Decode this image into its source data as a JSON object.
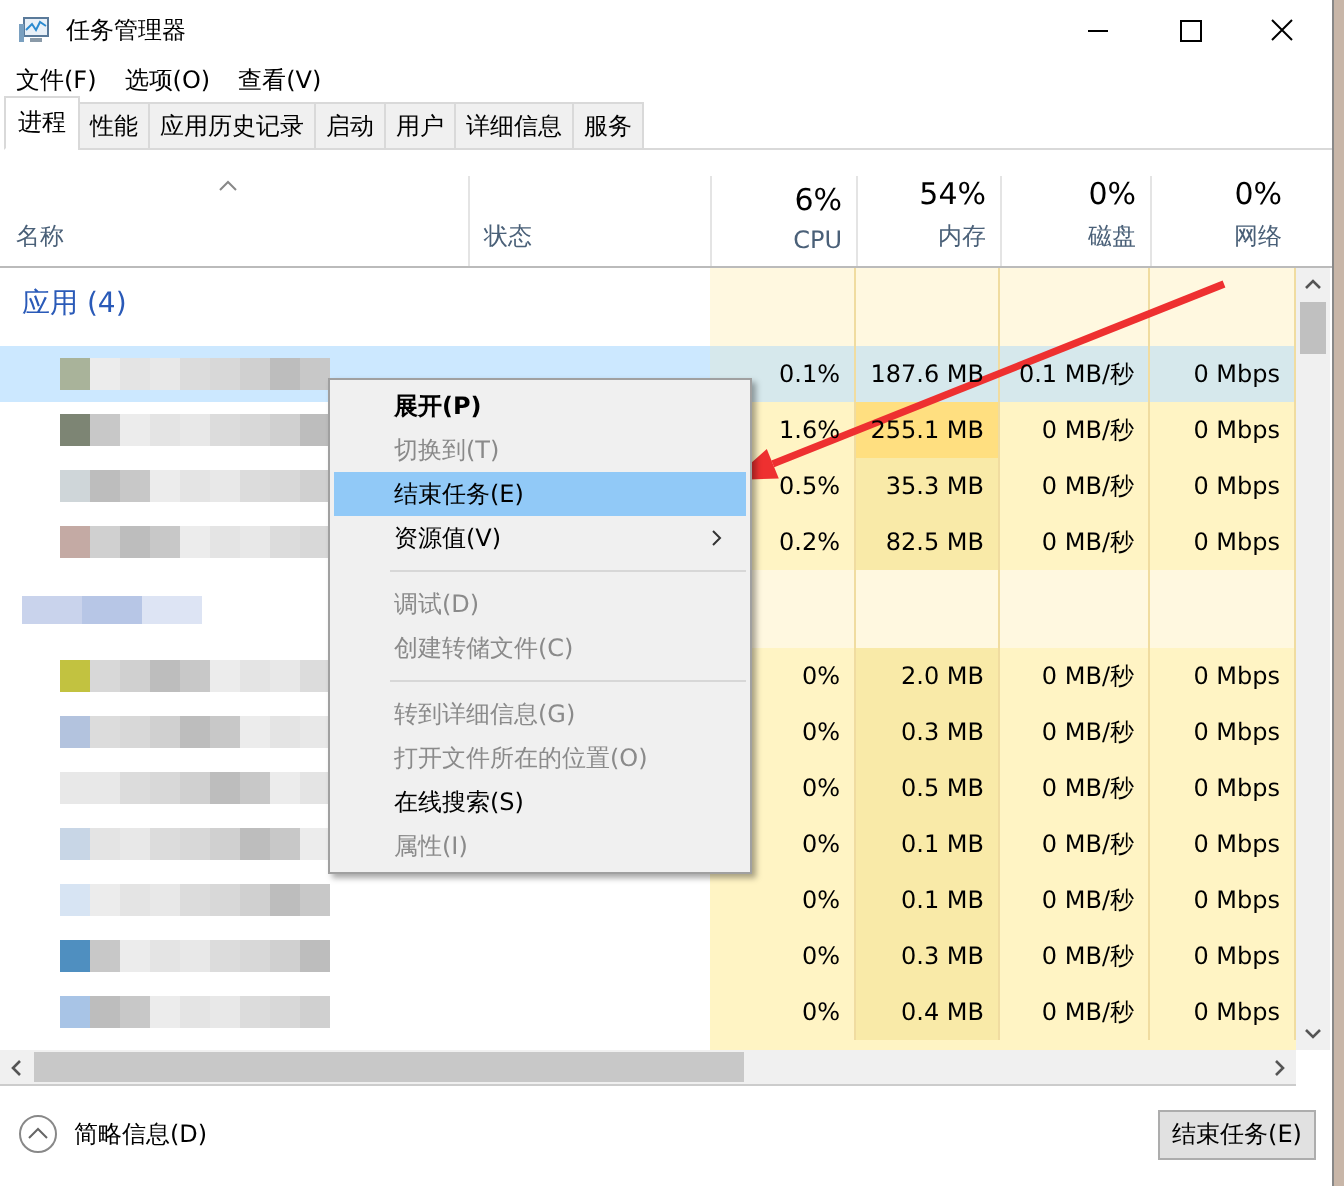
{
  "window": {
    "title": "任务管理器"
  },
  "menu": [
    "文件(F)",
    "选项(O)",
    "查看(V)"
  ],
  "tabs": [
    {
      "label": "进程",
      "selected": true
    },
    {
      "label": "性能",
      "selected": false
    },
    {
      "label": "应用历史记录",
      "selected": false
    },
    {
      "label": "启动",
      "selected": false
    },
    {
      "label": "用户",
      "selected": false
    },
    {
      "label": "详细信息",
      "selected": false
    },
    {
      "label": "服务",
      "selected": false
    }
  ],
  "columns": {
    "name": "名称",
    "status": "状态",
    "metrics": [
      {
        "percent": "6%",
        "label": "CPU"
      },
      {
        "percent": "54%",
        "label": "内存"
      },
      {
        "percent": "0%",
        "label": "磁盘"
      },
      {
        "percent": "0%",
        "label": "网络"
      }
    ]
  },
  "sections": [
    {
      "header": "应用 (4)",
      "rows": [
        {
          "cpu": "0.1%",
          "memory": "187.6 MB",
          "disk": "0.1 MB/秒",
          "network": "0 Mbps",
          "selected": true,
          "memory_hot": false
        },
        {
          "cpu": "1.6%",
          "memory": "255.1 MB",
          "disk": "0 MB/秒",
          "network": "0 Mbps",
          "selected": false,
          "memory_hot": true
        },
        {
          "cpu": "0.5%",
          "memory": "35.3 MB",
          "disk": "0 MB/秒",
          "network": "0 Mbps",
          "selected": false,
          "memory_hot": false
        },
        {
          "cpu": "0.2%",
          "memory": "82.5 MB",
          "disk": "0 MB/秒",
          "network": "0 Mbps",
          "selected": false,
          "memory_hot": false
        }
      ]
    },
    {
      "rows": [
        {
          "cpu": "0%",
          "memory": "2.0 MB",
          "disk": "0 MB/秒",
          "network": "0 Mbps",
          "selected": false,
          "memory_hot": false
        },
        {
          "cpu": "0%",
          "memory": "0.3 MB",
          "disk": "0 MB/秒",
          "network": "0 Mbps",
          "selected": false,
          "memory_hot": false
        },
        {
          "cpu": "0%",
          "memory": "0.5 MB",
          "disk": "0 MB/秒",
          "network": "0 Mbps",
          "selected": false,
          "memory_hot": false
        },
        {
          "cpu": "0%",
          "memory": "0.1 MB",
          "disk": "0 MB/秒",
          "network": "0 Mbps",
          "selected": false,
          "memory_hot": false
        },
        {
          "cpu": "0%",
          "memory": "0.1 MB",
          "disk": "0 MB/秒",
          "network": "0 Mbps",
          "selected": false,
          "memory_hot": false
        },
        {
          "cpu": "0%",
          "memory": "0.3 MB",
          "disk": "0 MB/秒",
          "network": "0 Mbps",
          "selected": false,
          "memory_hot": false
        },
        {
          "cpu": "0%",
          "memory": "0.4 MB",
          "disk": "0 MB/秒",
          "network": "0 Mbps",
          "selected": false,
          "memory_hot": false
        }
      ]
    }
  ],
  "context_menu": [
    {
      "kind": "item",
      "label": "展开(P)",
      "bold": true,
      "disabled": false,
      "selected": false,
      "submenu": false
    },
    {
      "kind": "item",
      "label": "切换到(T)",
      "bold": false,
      "disabled": true,
      "selected": false,
      "submenu": false
    },
    {
      "kind": "item",
      "label": "结束任务(E)",
      "bold": false,
      "disabled": false,
      "selected": true,
      "submenu": false
    },
    {
      "kind": "item",
      "label": "资源值(V)",
      "bold": false,
      "disabled": false,
      "selected": false,
      "submenu": true
    },
    {
      "kind": "separator"
    },
    {
      "kind": "item",
      "label": "调试(D)",
      "bold": false,
      "disabled": true,
      "selected": false,
      "submenu": false
    },
    {
      "kind": "item",
      "label": "创建转储文件(C)",
      "bold": false,
      "disabled": true,
      "selected": false,
      "submenu": false
    },
    {
      "kind": "separator"
    },
    {
      "kind": "item",
      "label": "转到详细信息(G)",
      "bold": false,
      "disabled": true,
      "selected": false,
      "submenu": false
    },
    {
      "kind": "item",
      "label": "打开文件所在的位置(O)",
      "bold": false,
      "disabled": true,
      "selected": false,
      "submenu": false
    },
    {
      "kind": "item",
      "label": "在线搜索(S)",
      "bold": false,
      "disabled": false,
      "selected": false,
      "submenu": false
    },
    {
      "kind": "item",
      "label": "属性(I)",
      "bold": false,
      "disabled": true,
      "selected": false,
      "submenu": false
    }
  ],
  "footer": {
    "details_toggle": "简略信息(D)",
    "end_task_button": "结束任务(E)"
  }
}
